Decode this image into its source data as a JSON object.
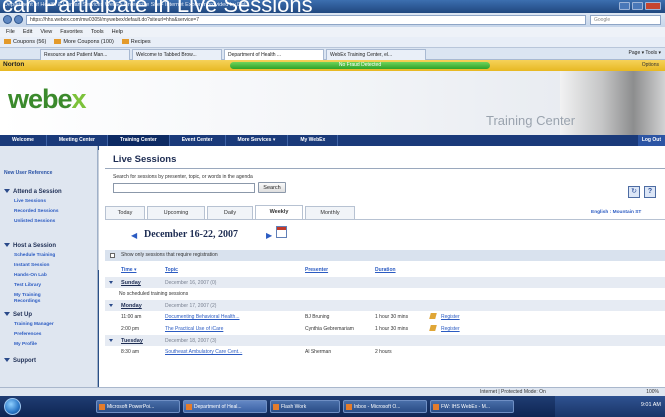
{
  "slide_title": "can Participate in Live Sessions",
  "browser": {
    "window_title": "Department of Health & Human Services WebEx Enterprise Site - Internet Explorer provided by Dell",
    "url": "https://hhs.webex.com/mw0305l/mywebex/default.do?siteurl=hhs&service=7",
    "search_placeholder": "Google",
    "menu": [
      "File",
      "Edit",
      "View",
      "Favorites",
      "Tools",
      "Help"
    ],
    "links": [
      "Coupons (56)",
      "More Coupons (100)",
      "Recipes"
    ],
    "tabs": [
      "Resource and Patient Man...",
      "Welcome to Tabbed Brow...",
      "Department of Health ...",
      "WebEx Training Center, el..."
    ],
    "commands": "Page ▾  Tools ▾",
    "norton": {
      "logo": "Norton",
      "status": "No Fraud Detected",
      "options": "Options"
    },
    "status_zone": "Internet | Protected Mode: On",
    "zoom": "100%"
  },
  "webex": {
    "logo_main": "webe",
    "logo_x": "x",
    "product_label": "Training Center",
    "nav": [
      "Welcome",
      "Meeting Center",
      "Training Center",
      "Event Center",
      "More Services ▾",
      "My WebEx"
    ],
    "logout": "Log Out"
  },
  "leftnav": {
    "top_link": "New User Reference",
    "sections": [
      {
        "title": "Attend a Session",
        "items": [
          "Live Sessions",
          "Recorded Sessions",
          "Unlisted Sessions"
        ]
      },
      {
        "title": "Host a Session",
        "items": [
          "Schedule Training",
          "Instant Session",
          "Hands-On Lab",
          "Test Library",
          "My Training Recordings"
        ]
      },
      {
        "title": "Set Up",
        "items": [
          "Training Manager",
          "Preferences",
          "My Profile"
        ]
      },
      {
        "title": "Support",
        "items": []
      }
    ]
  },
  "main": {
    "title": "Live Sessions",
    "search_desc": "Search for sessions by presenter, topic, or words in the agenda",
    "search_button": "Search",
    "refresh_label": "↻",
    "help_label": "?",
    "view_tabs": [
      "Today",
      "Upcoming",
      "Daily",
      "Weekly",
      "Monthly"
    ],
    "active_tab": "Weekly",
    "timezone": "English : Mountain ST",
    "date_prev": "◀",
    "date_range": "December 16-22, 2007",
    "date_next": "▶",
    "registration_filter": "Show only sessions that require registration",
    "columns": {
      "time": "Time ▾",
      "topic": "Topic",
      "presenter": "Presenter",
      "duration": "Duration"
    },
    "days": [
      {
        "name": "Sunday",
        "date": "December 16, 2007 (0)",
        "sessions": [],
        "empty_text": "No scheduled training sessions"
      },
      {
        "name": "Monday",
        "date": "December 17, 2007 (2)",
        "sessions": [
          {
            "time": "11:00 am",
            "topic": "Documenting Behavioral Health...",
            "presenter": "BJ Bruning",
            "duration": "1 hour 30 mins",
            "register": "Register"
          },
          {
            "time": "2:00 pm",
            "topic": "The Practical Use of iCare",
            "presenter": "Cynthia Gebremariam",
            "duration": "1 hour 30 mins",
            "register": "Register"
          }
        ]
      },
      {
        "name": "Tuesday",
        "date": "December 18, 2007 (3)",
        "sessions": [
          {
            "time": "8:30 am",
            "topic": "Southeast Ambulatory Care Cent...",
            "presenter": "Al Sherman",
            "duration": "2 hours",
            "register": ""
          }
        ]
      }
    ]
  },
  "taskbar": {
    "items": [
      "Microsoft PowerPoi...",
      "Department of Heal...",
      "Flash Work",
      "Inbox - Microsoft O...",
      "FW: IHS WebEx - M..."
    ],
    "clock": "9:01 AM"
  }
}
